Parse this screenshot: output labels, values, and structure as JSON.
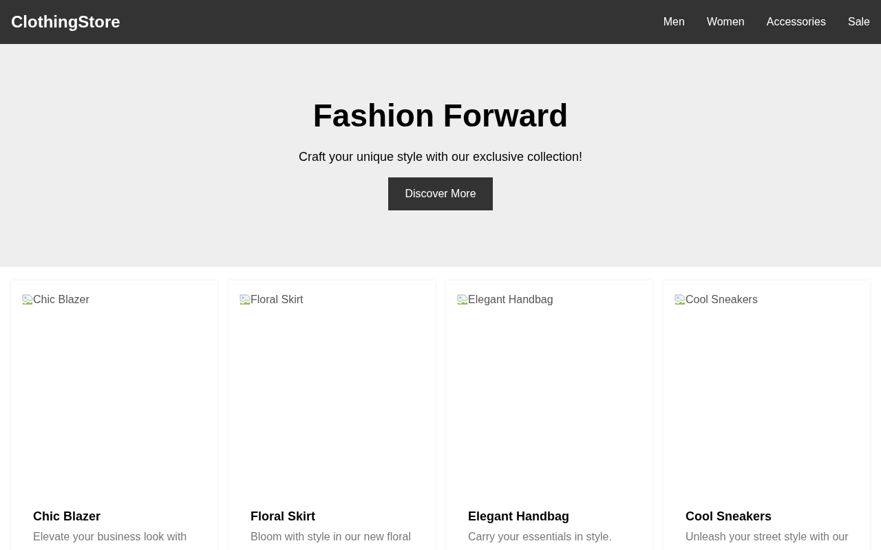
{
  "header": {
    "logo": "ClothingStore",
    "nav": [
      {
        "label": "Men"
      },
      {
        "label": "Women"
      },
      {
        "label": "Accessories"
      },
      {
        "label": "Sale"
      }
    ]
  },
  "hero": {
    "title": "Fashion Forward",
    "subtitle": "Craft your unique style with our exclusive collection!",
    "button": "Discover More"
  },
  "products": [
    {
      "image_alt": "Chic Blazer",
      "name": "Chic Blazer",
      "description": "Elevate your business look with"
    },
    {
      "image_alt": "Floral Skirt",
      "name": "Floral Skirt",
      "description": "Bloom with style in our new floral"
    },
    {
      "image_alt": "Elegant Handbag",
      "name": "Elegant Handbag",
      "description": "Carry your essentials in style."
    },
    {
      "image_alt": "Cool Sneakers",
      "name": "Cool Sneakers",
      "description": "Unleash your street style with our"
    }
  ]
}
